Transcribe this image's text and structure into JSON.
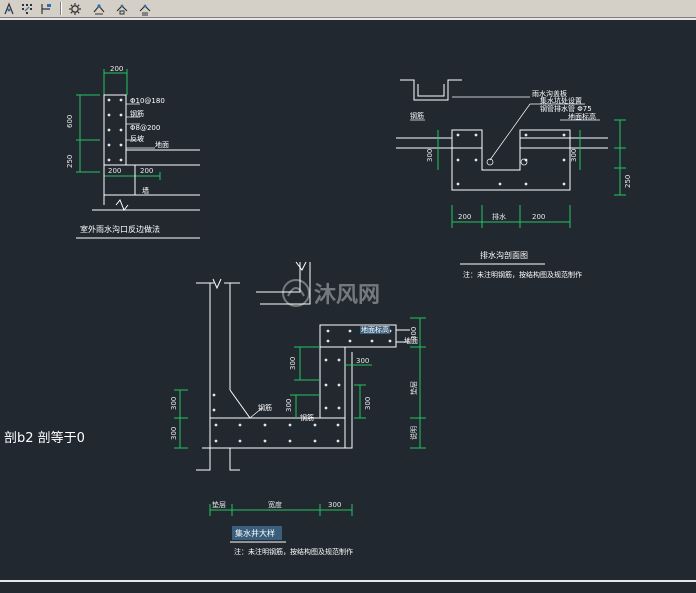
{
  "toolbar": {
    "buttons": [
      {
        "name": "snap-icon"
      },
      {
        "name": "grid-icon"
      },
      {
        "name": "ortho-icon"
      },
      {
        "name": "gear-icon"
      },
      {
        "name": "point-style-icon"
      },
      {
        "name": "point-node-icon"
      },
      {
        "name": "point-settings-icon"
      }
    ]
  },
  "colors": {
    "background": "#212830",
    "line_white": "#ffffff",
    "dimension_green": "#22c55e",
    "rebar": "#e5e5e5",
    "highlight_box": "#3a5f7c"
  },
  "detail_top_left": {
    "dims": [
      "200",
      "600",
      "250",
      "200",
      "200"
    ],
    "callouts": [
      "Φ10@180",
      "钢筋",
      "Φ8@200",
      "反坡",
      "地面",
      "墙"
    ],
    "title": "室外雨水沟口反边做法"
  },
  "detail_top_right": {
    "callouts": [
      "雨水沟盖板",
      "集水坑处设置",
      "钢管排水管 Φ75",
      "地面标高",
      "钢筋"
    ],
    "dims": [
      "300",
      "300",
      "250",
      "200",
      "排水",
      "200"
    ],
    "title": "排水沟剖面图",
    "note": "注：未注明钢筋，按结构图及规范制作"
  },
  "watermark": {
    "text": "沐风网"
  },
  "side_label": {
    "text": "剖b2 剖等于0"
  },
  "detail_main": {
    "dims": [
      "300",
      "300",
      "300",
      "300",
      "300",
      "300",
      "300"
    ],
    "callouts": [
      "地面标高",
      "钢筋",
      "钢筋",
      "地面",
      "垫层",
      "说明"
    ],
    "bottom_dims": [
      "垫层",
      "宽度",
      "300"
    ],
    "title": "集水井大样",
    "note": "注：未注明钢筋，按结构图及规范制作"
  }
}
